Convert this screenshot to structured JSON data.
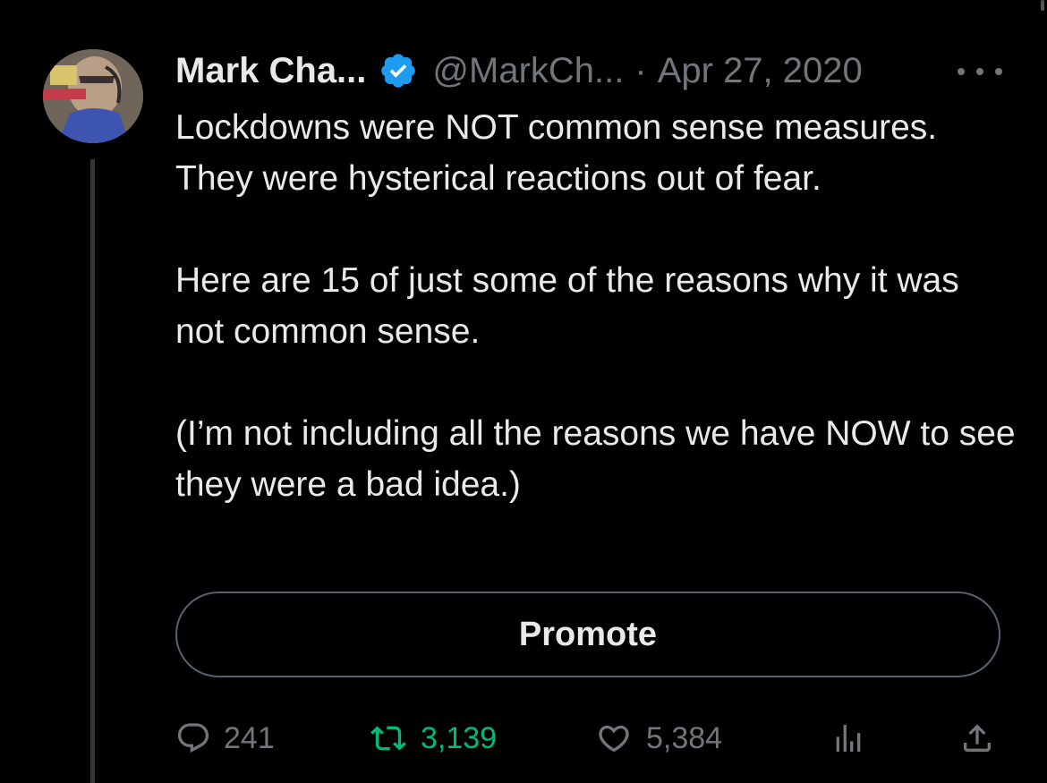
{
  "author": {
    "name": "Mark Cha...",
    "handle": "@MarkCh...",
    "separator": "·",
    "date": "Apr 27, 2020",
    "verified": true
  },
  "tweet": {
    "paragraphs": [
      "Lockdowns were NOT common sense measures. They were hysterical reactions out of fear.",
      "Here are 15 of just some of the reasons why it was not common sense.",
      "(I’m not including all the reasons we have NOW to see they were a bad idea.)"
    ]
  },
  "promote_label": "Promote",
  "actions": {
    "reply": {
      "icon": "reply-icon",
      "count": "241"
    },
    "retweet": {
      "icon": "retweet-icon",
      "count": "3,139",
      "active": true
    },
    "like": {
      "icon": "heart-icon",
      "count": "5,384"
    },
    "views": {
      "icon": "analytics-icon"
    },
    "share": {
      "icon": "share-icon"
    }
  },
  "colors": {
    "background": "#000000",
    "text": "#e7e9ea",
    "muted": "#71767b",
    "verified": "#1d9bf0",
    "retweet_active": "#00ba7c",
    "border": "#536471"
  }
}
